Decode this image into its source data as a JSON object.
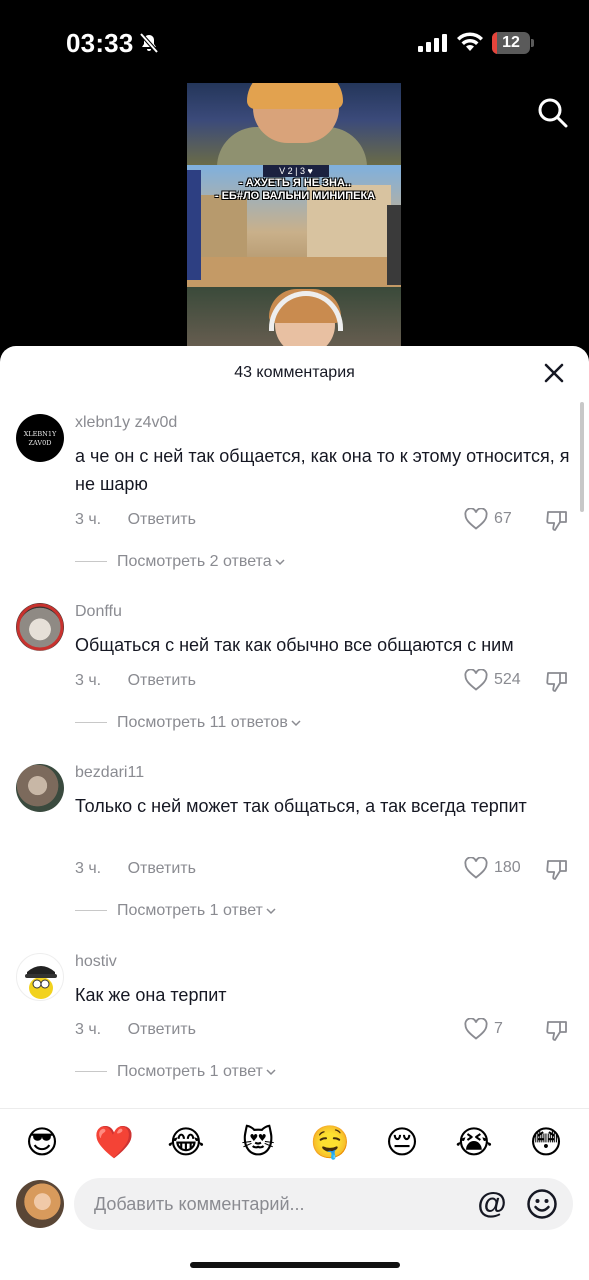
{
  "status_bar": {
    "time": "03:33",
    "battery_level": "12",
    "battery_fraction": 0.12,
    "icons": [
      "mute-icon",
      "signal-icon",
      "wifi-icon",
      "battery-icon"
    ]
  },
  "video": {
    "caption_line1": "- АХУЕТЬ Я НЕ ЗНА..",
    "caption_line2": "- ЕБ#ЛО ВАЛЬНИ МИНИПЕКА",
    "score": "V 2 | 3 ♥"
  },
  "sheet": {
    "title": "43 комментария"
  },
  "comments": [
    {
      "username": "xlebn1y z4v0d",
      "avatar_text": "XLEBN1Y\nZAV0D",
      "text": "а че он с ней так общается, как она то к этому относится, я не шарю",
      "time": "3 ч.",
      "reply_label": "Ответить",
      "likes": "67",
      "view_replies": "Посмотреть 2 ответа"
    },
    {
      "username": "Donffu",
      "text": "Общаться с ней так как обычно все общаются с ним",
      "time": "3 ч.",
      "reply_label": "Ответить",
      "likes": "524",
      "view_replies": "Посмотреть 11 ответов"
    },
    {
      "username": "bezdari11",
      "text": "Только с ней может так общаться, а так всегда терпит",
      "time": "3 ч.",
      "reply_label": "Ответить",
      "likes": "180",
      "view_replies": "Посмотреть 1 ответ"
    },
    {
      "username": "hostiv",
      "text": "Как же она терпит",
      "time": "3 ч.",
      "reply_label": "Ответить",
      "likes": "7",
      "view_replies": "Посмотреть 1 ответ"
    }
  ],
  "emoji_bar": [
    "😎",
    "❤️",
    "😂",
    "😻",
    "🤤",
    "😔",
    "😭",
    "😳"
  ],
  "composer": {
    "placeholder": "Добавить комментарий...",
    "at_symbol": "@"
  }
}
